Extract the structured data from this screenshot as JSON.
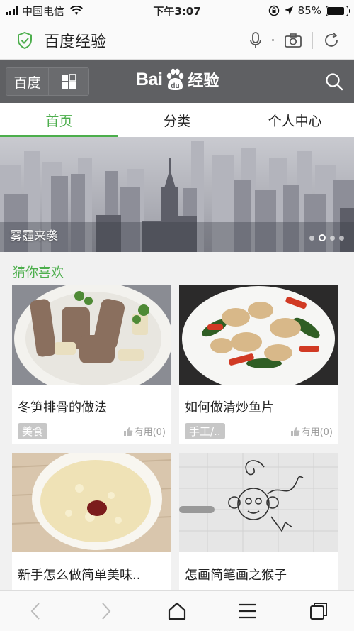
{
  "status_bar": {
    "carrier": "中国电信",
    "time": "下午3:07",
    "battery_text": "85%",
    "battery_level": 0.85
  },
  "browser_bar": {
    "title": "百度经验"
  },
  "site_header": {
    "baidu_button": "百度",
    "logo_text_left": "Bai",
    "logo_text_right": "经验"
  },
  "tabs": [
    {
      "label": "首页",
      "active": true
    },
    {
      "label": "分类",
      "active": false
    },
    {
      "label": "个人中心",
      "active": false
    }
  ],
  "banner": {
    "caption": "雾霾来袭",
    "slide_count": 4,
    "active_slide": 2
  },
  "section": {
    "title": "猜你喜欢"
  },
  "cards": [
    {
      "title": "冬笋排骨的做法",
      "tag": "美食",
      "likes": "有用(0)"
    },
    {
      "title": "如何做清炒鱼片",
      "tag": "手工/..",
      "likes": "有用(0)"
    },
    {
      "title": "新手怎么做简单美味..",
      "tag": "",
      "likes": ""
    },
    {
      "title": "怎画简笔画之猴子",
      "tag": "",
      "likes": ""
    }
  ],
  "colors": {
    "accent_green": "#4cae4c",
    "header_gray": "#5f6063"
  }
}
